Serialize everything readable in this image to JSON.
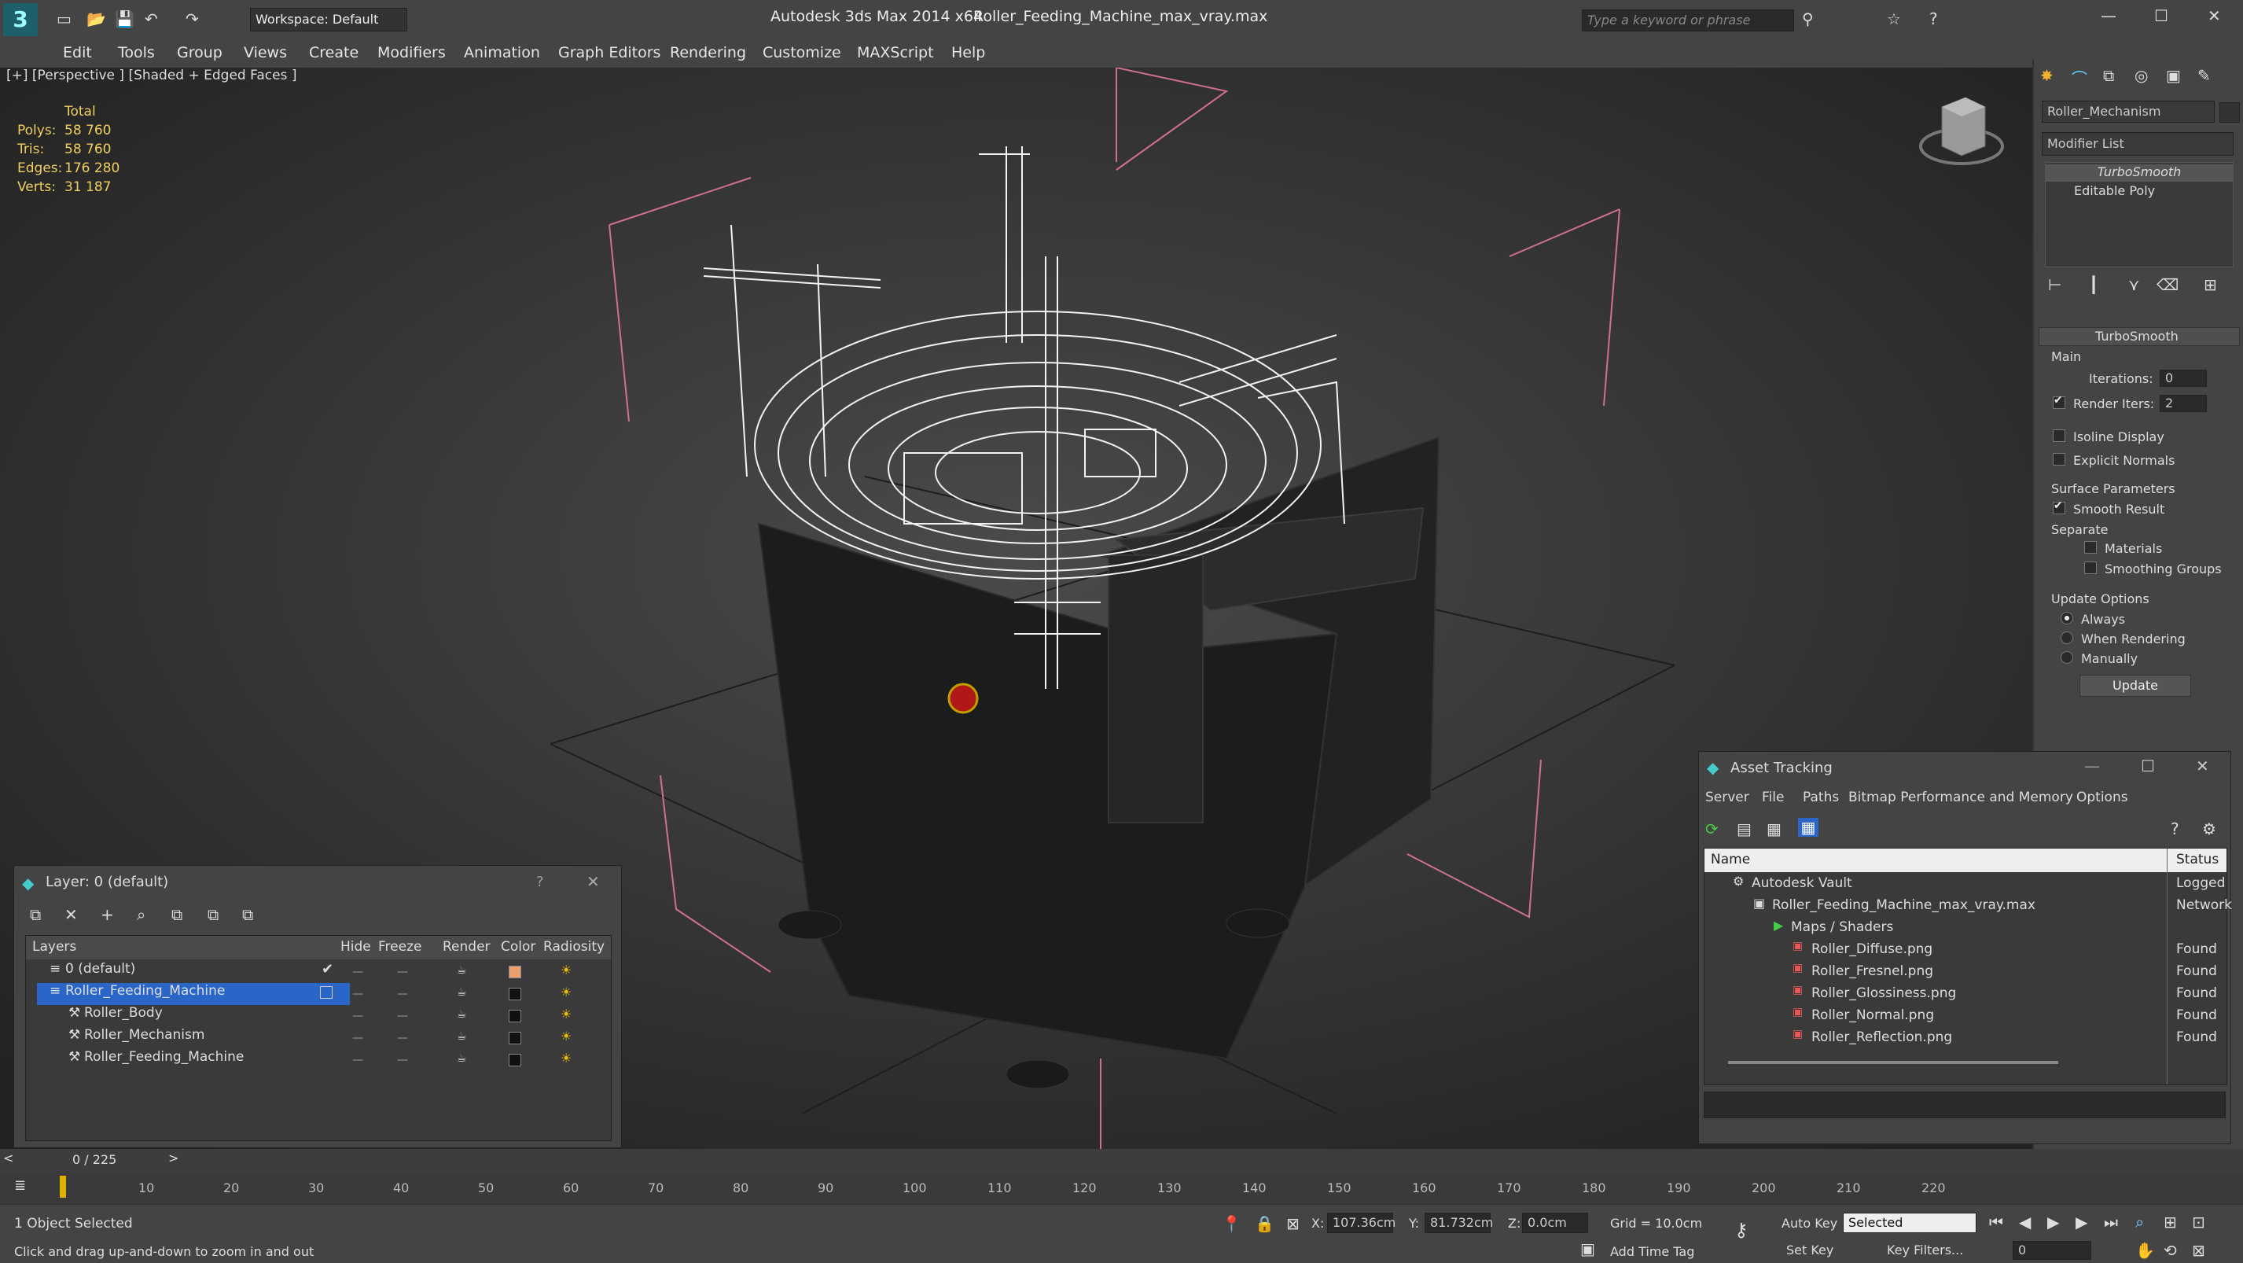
{
  "app": {
    "title": "Autodesk 3ds Max  2014 x64",
    "file": "Roller_Feeding_Machine_max_vray.max",
    "workspace": "Workspace: Default",
    "search_placeholder": "Type a keyword or phrase"
  },
  "menu": [
    "Edit",
    "Tools",
    "Group",
    "Views",
    "Create",
    "Modifiers",
    "Animation",
    "Graph Editors",
    "Rendering",
    "Customize",
    "MAXScript",
    "Help"
  ],
  "viewport": {
    "label": "[+] [Perspective ] [Shaded + Edged Faces ]",
    "stats": {
      "total_label": "Total",
      "polys_label": "Polys:",
      "polys": "58 760",
      "tris_label": "Tris:",
      "tris": "58 760",
      "edges_label": "Edges:",
      "edges": "176 280",
      "verts_label": "Verts:",
      "verts": "31 187"
    }
  },
  "right_panel": {
    "object_name": "Roller_Mechanism",
    "modifier_list": "Modifier List",
    "stack": [
      "TurboSmooth",
      "Editable Poly"
    ],
    "rollout_title": "TurboSmooth",
    "main_label": "Main",
    "iterations_label": "Iterations:",
    "iterations": "0",
    "render_iters_label": "Render Iters:",
    "render_iters": "2",
    "isoline": "Isoline Display",
    "explicit_normals": "Explicit Normals",
    "surface_params": "Surface Parameters",
    "smooth_result": "Smooth Result",
    "separate": "Separate",
    "materials": "Materials",
    "smoothing_groups": "Smoothing Groups",
    "update_options": "Update Options",
    "always": "Always",
    "when_rendering": "When Rendering",
    "manually": "Manually",
    "update_button": "Update"
  },
  "layer_window": {
    "title": "Layer: 0 (default)",
    "help": "?",
    "columns": [
      "Layers",
      "Hide",
      "Freeze",
      "Render",
      "Color",
      "Radiosity"
    ],
    "rows": [
      {
        "name": "0 (default)",
        "color": "#e8a070"
      },
      {
        "name": "Roller_Feeding_Machine",
        "color": "#111111"
      },
      {
        "name": "Roller_Body",
        "color": "#111111"
      },
      {
        "name": "Roller_Mechanism",
        "color": "#111111"
      },
      {
        "name": "Roller_Feeding_Machine",
        "color": "#111111"
      }
    ]
  },
  "asset_window": {
    "title": "Asset Tracking",
    "menu": [
      "Server",
      "File",
      "Paths",
      "Bitmap Performance and Memory",
      "Options"
    ],
    "col_name": "Name",
    "col_status": "Status",
    "rows": [
      {
        "name": "Autodesk Vault",
        "status": "Logged"
      },
      {
        "name": "Roller_Feeding_Machine_max_vray.max",
        "status": "Network"
      },
      {
        "name": "Maps / Shaders",
        "status": ""
      },
      {
        "name": "Roller_Diffuse.png",
        "status": "Found"
      },
      {
        "name": "Roller_Fresnel.png",
        "status": "Found"
      },
      {
        "name": "Roller_Glossiness.png",
        "status": "Found"
      },
      {
        "name": "Roller_Normal.png",
        "status": "Found"
      },
      {
        "name": "Roller_Reflection.png",
        "status": "Found"
      }
    ]
  },
  "timeline": {
    "frame": "0 / 225",
    "ticks": [
      "10",
      "20",
      "30",
      "40",
      "50",
      "60",
      "70",
      "80",
      "90",
      "100",
      "110",
      "120",
      "130",
      "140",
      "150",
      "160",
      "170",
      "180",
      "190",
      "200",
      "210",
      "220"
    ]
  },
  "status": {
    "selected": "1 Object Selected",
    "hint": "Click and drag up-and-down to zoom in and out",
    "x_label": "X:",
    "x": "107.36cm",
    "y_label": "Y:",
    "y": "81.732cm",
    "z_label": "Z:",
    "z": "0.0cm",
    "grid": "Grid = 10.0cm",
    "auto_key": "Auto Key",
    "set_key": "Set Key",
    "selected_dropdown": "Selected",
    "key_filters": "Key Filters...",
    "add_time_tag": "Add Time Tag",
    "frame_field": "0"
  }
}
